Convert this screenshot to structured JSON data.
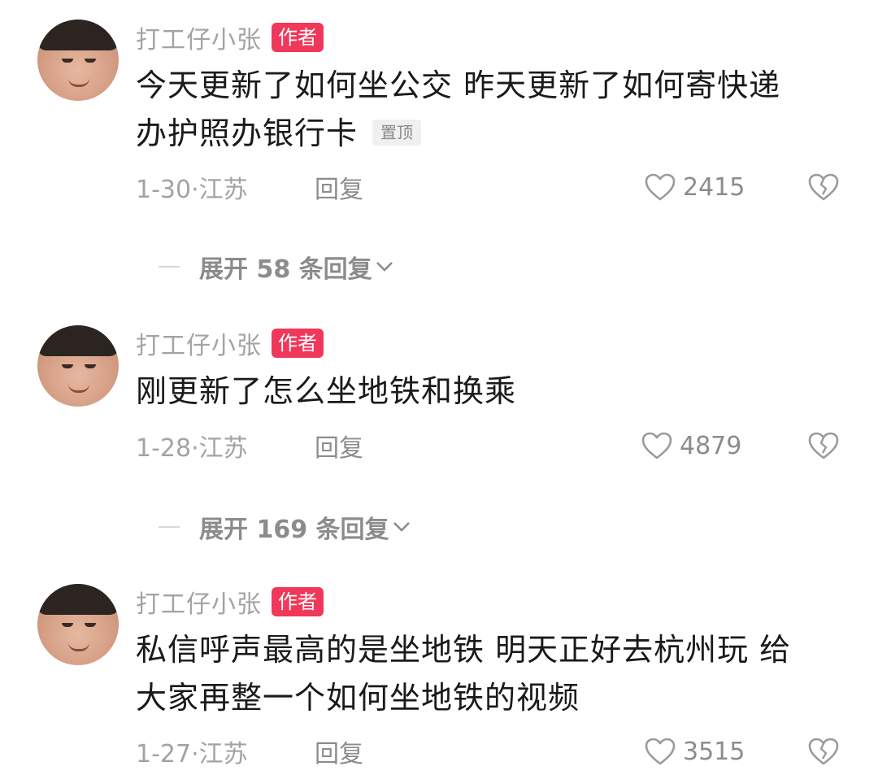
{
  "comments": [
    {
      "username": "打工仔小张",
      "badge": "作者",
      "lines": [
        "今天更新了如何坐公交 昨天更新了如何寄快递",
        "办护照办银行卡"
      ],
      "pin_label": "置顶",
      "date_location": "1-30·江苏",
      "reply_label": "回复",
      "likes": "2415",
      "expand_label": "展开 58 条回复"
    },
    {
      "username": "打工仔小张",
      "badge": "作者",
      "lines": [
        "刚更新了怎么坐地铁和换乘"
      ],
      "date_location": "1-28·江苏",
      "reply_label": "回复",
      "likes": "4879",
      "expand_label": "展开 169 条回复"
    },
    {
      "username": "打工仔小张",
      "badge": "作者",
      "lines": [
        "私信呼声最高的是坐地铁 明天正好去杭州玩 给",
        "大家再整一个如何坐地铁的视频"
      ],
      "date_location": "1-27·江苏",
      "reply_label": "回复",
      "likes": "3515"
    }
  ],
  "colors": {
    "author_badge": "#f0385a",
    "pin_badge_bg": "#f0f0f0",
    "muted_text": "#a3a3a3"
  },
  "icons": [
    "heart-outline-icon",
    "broken-heart-icon",
    "chevron-down-icon"
  ]
}
